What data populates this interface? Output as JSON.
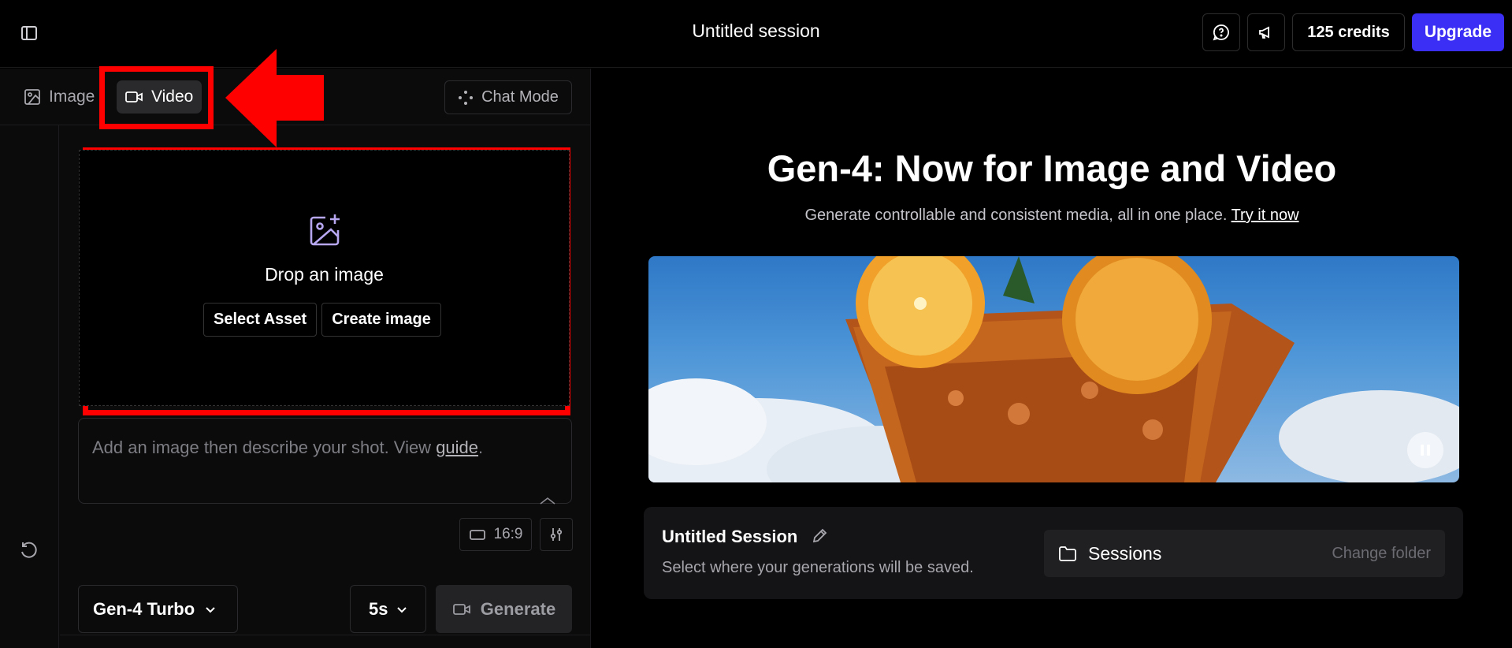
{
  "header": {
    "session_title": "Untitled session",
    "credits_label": "125 credits",
    "upgrade_label": "Upgrade"
  },
  "mode_bar": {
    "tabs": [
      {
        "label": "Image",
        "icon": "image-icon",
        "active": false
      },
      {
        "label": "Video",
        "icon": "video-camera-icon",
        "active": true
      }
    ],
    "chat_mode_label": "Chat Mode"
  },
  "drop_zone": {
    "title": "Drop an image",
    "select_asset_label": "Select Asset",
    "create_image_label": "Create image"
  },
  "prompt": {
    "placeholder_before": "Add an image then describe your shot. View ",
    "guide_link": "guide",
    "placeholder_after": "."
  },
  "controls": {
    "aspect_ratio": "16:9",
    "model": "Gen-4 Turbo",
    "duration": "5s",
    "generate_label": "Generate"
  },
  "hero": {
    "title": "Gen-4: Now for Image and Video",
    "subtitle": "Generate controllable and consistent media, all in one place.",
    "cta_link": "Try it now"
  },
  "session_card": {
    "name": "Untitled Session",
    "description": "Select where your generations will be saved.",
    "folder_label": "Sessions",
    "change_folder_label": "Change folder"
  },
  "colors": {
    "accent": "#3b2ef5",
    "annotation": "#ff0000",
    "panel_bg": "#0b0b0c"
  }
}
